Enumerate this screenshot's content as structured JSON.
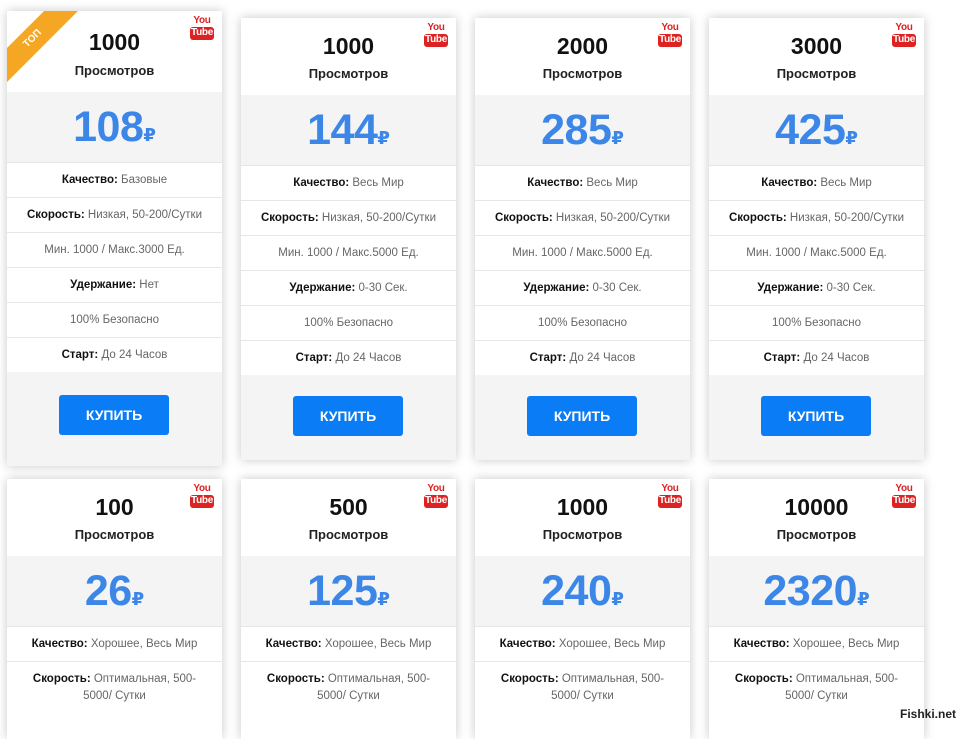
{
  "ribbon": "ТОП",
  "yt_you": "You",
  "yt_tube": "Tube",
  "buy_label": "КУПИТЬ",
  "currency": "₽",
  "watermark": "Fishki.net",
  "colors": {
    "accent": "#3b86e6",
    "button": "#0a7cf5",
    "ribbon": "#f5a623",
    "youtube": "#dd2222"
  },
  "cards": [
    {
      "qty": "1000",
      "unit": "Просмотров",
      "price": "108",
      "features": [
        {
          "label": "Качество:",
          "value": " Базовые"
        },
        {
          "label": "Скорость:",
          "value": " Низкая, 50-200/Сутки"
        },
        {
          "label": "",
          "value": "Мин. 1000 / Макс.3000 Ед."
        },
        {
          "label": "Удержание:",
          "value": " Нет"
        },
        {
          "label": "",
          "value": "100% Безопасно"
        },
        {
          "label": "Старт:",
          "value": " До 24 Часов"
        }
      ]
    },
    {
      "qty": "1000",
      "unit": "Просмотров",
      "price": "144",
      "features": [
        {
          "label": "Качество:",
          "value": " Весь Мир"
        },
        {
          "label": "Скорость:",
          "value": " Низкая, 50-200/Сутки"
        },
        {
          "label": "",
          "value": "Мин. 1000 / Макс.5000 Ед."
        },
        {
          "label": "Удержание:",
          "value": " 0-30 Сек."
        },
        {
          "label": "",
          "value": "100% Безопасно"
        },
        {
          "label": "Старт:",
          "value": " До 24 Часов"
        }
      ]
    },
    {
      "qty": "2000",
      "unit": "Просмотров",
      "price": "285",
      "features": [
        {
          "label": "Качество:",
          "value": " Весь Мир"
        },
        {
          "label": "Скорость:",
          "value": " Низкая, 50-200/Сутки"
        },
        {
          "label": "",
          "value": "Мин. 1000 / Макс.5000 Ед."
        },
        {
          "label": "Удержание:",
          "value": " 0-30 Сек."
        },
        {
          "label": "",
          "value": "100% Безопасно"
        },
        {
          "label": "Старт:",
          "value": " До 24 Часов"
        }
      ]
    },
    {
      "qty": "3000",
      "unit": "Просмотров",
      "price": "425",
      "features": [
        {
          "label": "Качество:",
          "value": " Весь Мир"
        },
        {
          "label": "Скорость:",
          "value": " Низкая, 50-200/Сутки"
        },
        {
          "label": "",
          "value": "Мин. 1000 / Макс.5000 Ед."
        },
        {
          "label": "Удержание:",
          "value": " 0-30 Сек."
        },
        {
          "label": "",
          "value": "100% Безопасно"
        },
        {
          "label": "Старт:",
          "value": " До 24 Часов"
        }
      ]
    },
    {
      "qty": "100",
      "unit": "Просмотров",
      "price": "26",
      "features": [
        {
          "label": "Качество:",
          "value": " Хорошее, Весь Мир"
        },
        {
          "label": "Скорость:",
          "value": " Оптимальная, 500-5000/ Сутки"
        }
      ]
    },
    {
      "qty": "500",
      "unit": "Просмотров",
      "price": "125",
      "features": [
        {
          "label": "Качество:",
          "value": " Хорошее, Весь Мир"
        },
        {
          "label": "Скорость:",
          "value": " Оптимальная, 500-5000/ Сутки"
        }
      ]
    },
    {
      "qty": "1000",
      "unit": "Просмотров",
      "price": "240",
      "features": [
        {
          "label": "Качество:",
          "value": " Хорошее, Весь Мир"
        },
        {
          "label": "Скорость:",
          "value": " Оптимальная, 500-5000/ Сутки"
        }
      ]
    },
    {
      "qty": "10000",
      "unit": "Просмотров",
      "price": "2320",
      "features": [
        {
          "label": "Качество:",
          "value": " Хорошее, Весь Мир"
        },
        {
          "label": "Скорость:",
          "value": " Оптимальная, 500-5000/ Сутки"
        }
      ]
    }
  ]
}
